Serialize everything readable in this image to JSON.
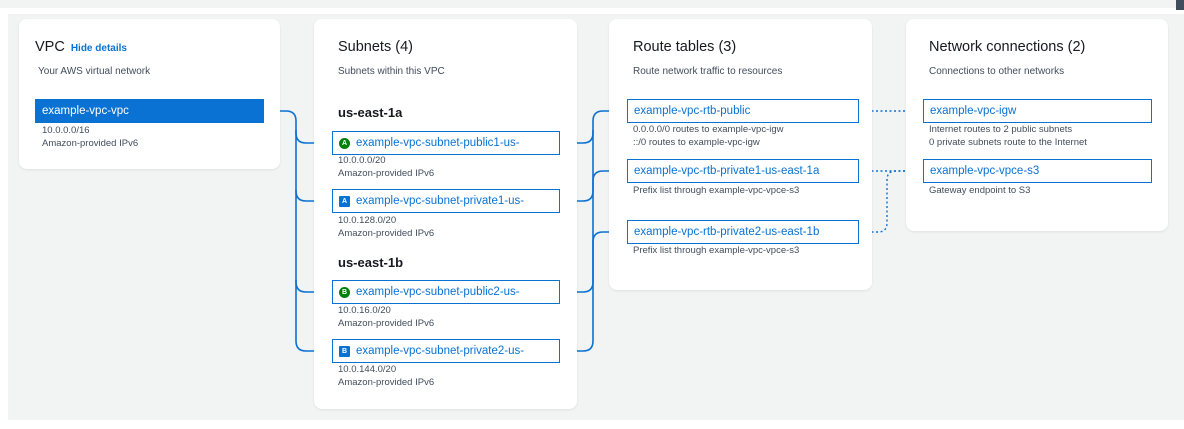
{
  "colors": {
    "accent": "#0972d3",
    "public_badge": "#037f0c",
    "background": "#f2f3f3"
  },
  "vpc": {
    "title": "VPC",
    "hide_details": "Hide details",
    "subtitle": "Your AWS virtual network",
    "name": "example-vpc-vpc",
    "cidr": "10.0.0.0/16",
    "ipv6": "Amazon-provided IPv6"
  },
  "subnets": {
    "title": "Subnets (4)",
    "subtitle": "Subnets within this VPC",
    "zones": [
      {
        "name": "us-east-1a",
        "items": [
          {
            "badge": "A",
            "type": "public",
            "name": "example-vpc-subnet-public1-us-",
            "cidr": "10.0.0.0/20",
            "ipv6": "Amazon-provided IPv6"
          },
          {
            "badge": "A",
            "type": "private",
            "name": "example-vpc-subnet-private1-us-",
            "cidr": "10.0.128.0/20",
            "ipv6": "Amazon-provided IPv6"
          }
        ]
      },
      {
        "name": "us-east-1b",
        "items": [
          {
            "badge": "B",
            "type": "public",
            "name": "example-vpc-subnet-public2-us-",
            "cidr": "10.0.16.0/20",
            "ipv6": "Amazon-provided IPv6"
          },
          {
            "badge": "B",
            "type": "private",
            "name": "example-vpc-subnet-private2-us-",
            "cidr": "10.0.144.0/20",
            "ipv6": "Amazon-provided IPv6"
          }
        ]
      }
    ]
  },
  "route_tables": {
    "title": "Route tables (3)",
    "subtitle": "Route network traffic to resources",
    "items": [
      {
        "name": "example-vpc-rtb-public",
        "details": [
          "0.0.0.0/0 routes to example-vpc-igw",
          "::/0 routes to example-vpc-igw"
        ]
      },
      {
        "name": "example-vpc-rtb-private1-us-east-1a",
        "details": [
          "Prefix list through example-vpc-vpce-s3"
        ]
      },
      {
        "name": "example-vpc-rtb-private2-us-east-1b",
        "details": [
          "Prefix list through example-vpc-vpce-s3"
        ]
      }
    ]
  },
  "network_connections": {
    "title": "Network connections (2)",
    "subtitle": "Connections to other networks",
    "items": [
      {
        "name": "example-vpc-igw",
        "details": [
          "Internet routes to 2 public subnets",
          "0 private subnets route to the Internet"
        ]
      },
      {
        "name": "example-vpc-vpce-s3",
        "details": [
          "Gateway endpoint to S3"
        ]
      }
    ]
  }
}
